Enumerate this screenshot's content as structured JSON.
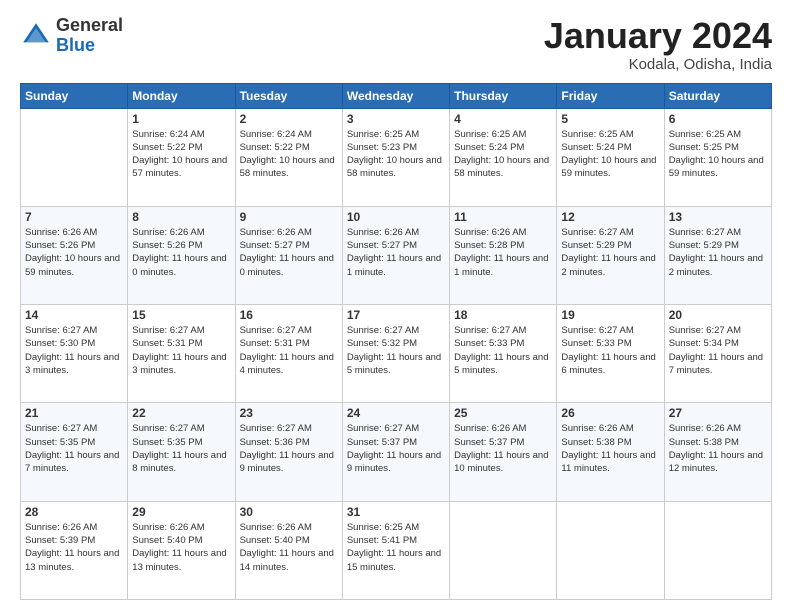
{
  "header": {
    "logo_general": "General",
    "logo_blue": "Blue",
    "month_title": "January 2024",
    "location": "Kodala, Odisha, India"
  },
  "weekdays": [
    "Sunday",
    "Monday",
    "Tuesday",
    "Wednesday",
    "Thursday",
    "Friday",
    "Saturday"
  ],
  "weeks": [
    [
      {
        "day": "",
        "sunrise": "",
        "sunset": "",
        "daylight": ""
      },
      {
        "day": "1",
        "sunrise": "Sunrise: 6:24 AM",
        "sunset": "Sunset: 5:22 PM",
        "daylight": "Daylight: 10 hours and 57 minutes."
      },
      {
        "day": "2",
        "sunrise": "Sunrise: 6:24 AM",
        "sunset": "Sunset: 5:22 PM",
        "daylight": "Daylight: 10 hours and 58 minutes."
      },
      {
        "day": "3",
        "sunrise": "Sunrise: 6:25 AM",
        "sunset": "Sunset: 5:23 PM",
        "daylight": "Daylight: 10 hours and 58 minutes."
      },
      {
        "day": "4",
        "sunrise": "Sunrise: 6:25 AM",
        "sunset": "Sunset: 5:24 PM",
        "daylight": "Daylight: 10 hours and 58 minutes."
      },
      {
        "day": "5",
        "sunrise": "Sunrise: 6:25 AM",
        "sunset": "Sunset: 5:24 PM",
        "daylight": "Daylight: 10 hours and 59 minutes."
      },
      {
        "day": "6",
        "sunrise": "Sunrise: 6:25 AM",
        "sunset": "Sunset: 5:25 PM",
        "daylight": "Daylight: 10 hours and 59 minutes."
      }
    ],
    [
      {
        "day": "7",
        "sunrise": "Sunrise: 6:26 AM",
        "sunset": "Sunset: 5:26 PM",
        "daylight": "Daylight: 10 hours and 59 minutes."
      },
      {
        "day": "8",
        "sunrise": "Sunrise: 6:26 AM",
        "sunset": "Sunset: 5:26 PM",
        "daylight": "Daylight: 11 hours and 0 minutes."
      },
      {
        "day": "9",
        "sunrise": "Sunrise: 6:26 AM",
        "sunset": "Sunset: 5:27 PM",
        "daylight": "Daylight: 11 hours and 0 minutes."
      },
      {
        "day": "10",
        "sunrise": "Sunrise: 6:26 AM",
        "sunset": "Sunset: 5:27 PM",
        "daylight": "Daylight: 11 hours and 1 minute."
      },
      {
        "day": "11",
        "sunrise": "Sunrise: 6:26 AM",
        "sunset": "Sunset: 5:28 PM",
        "daylight": "Daylight: 11 hours and 1 minute."
      },
      {
        "day": "12",
        "sunrise": "Sunrise: 6:27 AM",
        "sunset": "Sunset: 5:29 PM",
        "daylight": "Daylight: 11 hours and 2 minutes."
      },
      {
        "day": "13",
        "sunrise": "Sunrise: 6:27 AM",
        "sunset": "Sunset: 5:29 PM",
        "daylight": "Daylight: 11 hours and 2 minutes."
      }
    ],
    [
      {
        "day": "14",
        "sunrise": "Sunrise: 6:27 AM",
        "sunset": "Sunset: 5:30 PM",
        "daylight": "Daylight: 11 hours and 3 minutes."
      },
      {
        "day": "15",
        "sunrise": "Sunrise: 6:27 AM",
        "sunset": "Sunset: 5:31 PM",
        "daylight": "Daylight: 11 hours and 3 minutes."
      },
      {
        "day": "16",
        "sunrise": "Sunrise: 6:27 AM",
        "sunset": "Sunset: 5:31 PM",
        "daylight": "Daylight: 11 hours and 4 minutes."
      },
      {
        "day": "17",
        "sunrise": "Sunrise: 6:27 AM",
        "sunset": "Sunset: 5:32 PM",
        "daylight": "Daylight: 11 hours and 5 minutes."
      },
      {
        "day": "18",
        "sunrise": "Sunrise: 6:27 AM",
        "sunset": "Sunset: 5:33 PM",
        "daylight": "Daylight: 11 hours and 5 minutes."
      },
      {
        "day": "19",
        "sunrise": "Sunrise: 6:27 AM",
        "sunset": "Sunset: 5:33 PM",
        "daylight": "Daylight: 11 hours and 6 minutes."
      },
      {
        "day": "20",
        "sunrise": "Sunrise: 6:27 AM",
        "sunset": "Sunset: 5:34 PM",
        "daylight": "Daylight: 11 hours and 7 minutes."
      }
    ],
    [
      {
        "day": "21",
        "sunrise": "Sunrise: 6:27 AM",
        "sunset": "Sunset: 5:35 PM",
        "daylight": "Daylight: 11 hours and 7 minutes."
      },
      {
        "day": "22",
        "sunrise": "Sunrise: 6:27 AM",
        "sunset": "Sunset: 5:35 PM",
        "daylight": "Daylight: 11 hours and 8 minutes."
      },
      {
        "day": "23",
        "sunrise": "Sunrise: 6:27 AM",
        "sunset": "Sunset: 5:36 PM",
        "daylight": "Daylight: 11 hours and 9 minutes."
      },
      {
        "day": "24",
        "sunrise": "Sunrise: 6:27 AM",
        "sunset": "Sunset: 5:37 PM",
        "daylight": "Daylight: 11 hours and 9 minutes."
      },
      {
        "day": "25",
        "sunrise": "Sunrise: 6:26 AM",
        "sunset": "Sunset: 5:37 PM",
        "daylight": "Daylight: 11 hours and 10 minutes."
      },
      {
        "day": "26",
        "sunrise": "Sunrise: 6:26 AM",
        "sunset": "Sunset: 5:38 PM",
        "daylight": "Daylight: 11 hours and 11 minutes."
      },
      {
        "day": "27",
        "sunrise": "Sunrise: 6:26 AM",
        "sunset": "Sunset: 5:38 PM",
        "daylight": "Daylight: 11 hours and 12 minutes."
      }
    ],
    [
      {
        "day": "28",
        "sunrise": "Sunrise: 6:26 AM",
        "sunset": "Sunset: 5:39 PM",
        "daylight": "Daylight: 11 hours and 13 minutes."
      },
      {
        "day": "29",
        "sunrise": "Sunrise: 6:26 AM",
        "sunset": "Sunset: 5:40 PM",
        "daylight": "Daylight: 11 hours and 13 minutes."
      },
      {
        "day": "30",
        "sunrise": "Sunrise: 6:26 AM",
        "sunset": "Sunset: 5:40 PM",
        "daylight": "Daylight: 11 hours and 14 minutes."
      },
      {
        "day": "31",
        "sunrise": "Sunrise: 6:25 AM",
        "sunset": "Sunset: 5:41 PM",
        "daylight": "Daylight: 11 hours and 15 minutes."
      },
      {
        "day": "",
        "sunrise": "",
        "sunset": "",
        "daylight": ""
      },
      {
        "day": "",
        "sunrise": "",
        "sunset": "",
        "daylight": ""
      },
      {
        "day": "",
        "sunrise": "",
        "sunset": "",
        "daylight": ""
      }
    ]
  ]
}
